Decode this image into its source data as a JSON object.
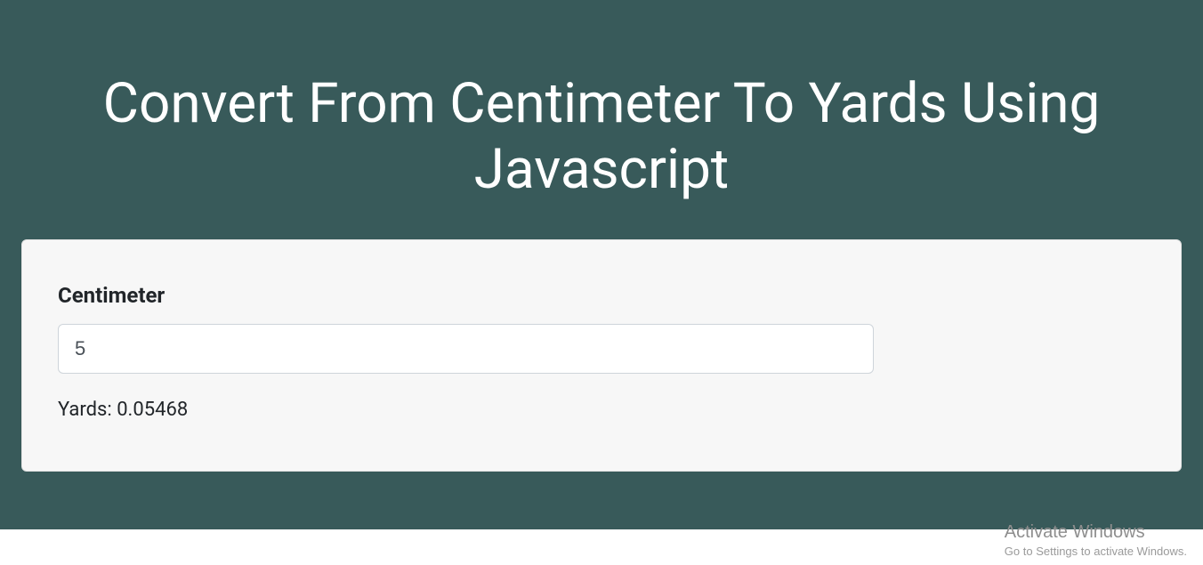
{
  "page": {
    "title": "Convert From Centimeter To Yards Using Javascript"
  },
  "form": {
    "label": "Centimeter",
    "input_value": "5",
    "result_text": "Yards: 0.05468"
  },
  "watermark": {
    "title": "Activate Windows",
    "subtitle": "Go to Settings to activate Windows."
  }
}
